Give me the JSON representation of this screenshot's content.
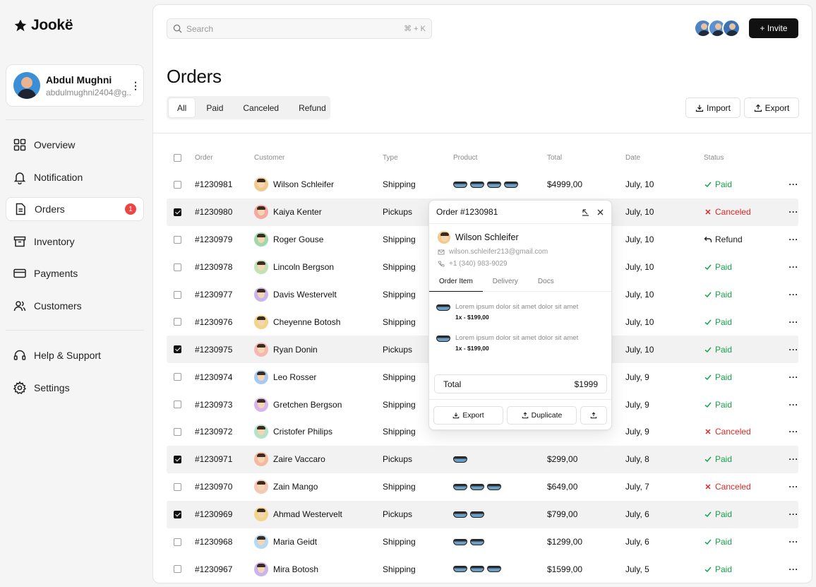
{
  "app": {
    "name": "Jookë"
  },
  "user": {
    "name": "Abdul Mughni",
    "email": "abdulmughni2404@g..."
  },
  "nav": [
    {
      "label": "Overview",
      "icon": "grid-icon"
    },
    {
      "label": "Notification",
      "icon": "bell-icon"
    },
    {
      "label": "Orders",
      "icon": "document-icon",
      "badge": "1",
      "active": true
    },
    {
      "label": "Inventory",
      "icon": "archive-icon"
    },
    {
      "label": "Payments",
      "icon": "credit-card-icon"
    },
    {
      "label": "Customers",
      "icon": "users-icon"
    }
  ],
  "nav_secondary": [
    {
      "label": "Help & Support",
      "icon": "headset-icon"
    },
    {
      "label": "Settings",
      "icon": "gear-icon"
    }
  ],
  "search": {
    "placeholder": "Search",
    "shortcut": "⌘ + K"
  },
  "invite_label": "+ Invite",
  "page": {
    "title": "Orders"
  },
  "tabs": [
    "All",
    "Paid",
    "Canceled",
    "Refund"
  ],
  "actions": {
    "import": "Import",
    "export": "Export"
  },
  "columns": [
    "Order",
    "Customer",
    "Type",
    "Product",
    "Total",
    "Date",
    "Status"
  ],
  "orders": [
    {
      "id": "#1230981",
      "customer": "Wilson Schleifer",
      "type": "Shipping",
      "products": 4,
      "total": "$4999,00",
      "date": "July, 10",
      "status": "Paid",
      "checked": false
    },
    {
      "id": "#1230980",
      "customer": "Kaiya Kenter",
      "type": "Pickups",
      "products": 0,
      "total": "",
      "date": "July, 10",
      "status": "Canceled",
      "checked": true
    },
    {
      "id": "#1230979",
      "customer": "Roger Gouse",
      "type": "Shipping",
      "products": 0,
      "total": "",
      "date": "July, 10",
      "status": "Refund",
      "checked": false
    },
    {
      "id": "#1230978",
      "customer": "Lincoln Bergson",
      "type": "Shipping",
      "products": 0,
      "total": "",
      "date": "July, 10",
      "status": "Paid",
      "checked": false
    },
    {
      "id": "#1230977",
      "customer": "Davis Westervelt",
      "type": "Shipping",
      "products": 0,
      "total": "",
      "date": "July, 10",
      "status": "Paid",
      "checked": false
    },
    {
      "id": "#1230976",
      "customer": "Cheyenne Botosh",
      "type": "Shipping",
      "products": 0,
      "total": "",
      "date": "July, 10",
      "status": "Paid",
      "checked": false
    },
    {
      "id": "#1230975",
      "customer": "Ryan Donin",
      "type": "Pickups",
      "products": 0,
      "total": "",
      "date": "July, 10",
      "status": "Paid",
      "checked": true
    },
    {
      "id": "#1230974",
      "customer": "Leo Rosser",
      "type": "Shipping",
      "products": 0,
      "total": "",
      "date": "July, 9",
      "status": "Paid",
      "checked": false
    },
    {
      "id": "#1230973",
      "customer": "Gretchen Bergson",
      "type": "Shipping",
      "products": 0,
      "total": "",
      "date": "July, 9",
      "status": "Paid",
      "checked": false
    },
    {
      "id": "#1230972",
      "customer": "Cristofer Philips",
      "type": "Shipping",
      "products": 0,
      "total": "",
      "date": "July, 9",
      "status": "Canceled",
      "checked": false
    },
    {
      "id": "#1230971",
      "customer": "Zaire Vaccaro",
      "type": "Pickups",
      "products": 1,
      "total": "$299,00",
      "date": "July, 8",
      "status": "Paid",
      "checked": true
    },
    {
      "id": "#1230970",
      "customer": "Zain Mango",
      "type": "Shipping",
      "products": 3,
      "total": "$649,00",
      "date": "July, 7",
      "status": "Canceled",
      "checked": false
    },
    {
      "id": "#1230969",
      "customer": "Ahmad Westervelt",
      "type": "Pickups",
      "products": 2,
      "total": "$799,00",
      "date": "July, 6",
      "status": "Paid",
      "checked": true
    },
    {
      "id": "#1230968",
      "customer": "Maria Geidt",
      "type": "Shipping",
      "products": 2,
      "total": "$1299,00",
      "date": "July, 6",
      "status": "Paid",
      "checked": false
    },
    {
      "id": "#1230967",
      "customer": "Mira Botosh",
      "type": "Shipping",
      "products": 3,
      "total": "$1599,00",
      "date": "July, 5",
      "status": "Paid",
      "checked": false
    }
  ],
  "status_colors": {
    "Paid": "#16a34a",
    "Canceled": "#dc2626",
    "Refund": "#222222"
  },
  "popover": {
    "title": "Order #1230981",
    "customer": "Wilson Schleifer",
    "email": "wilson.schleifer213@gmail.com",
    "phone": "+1 (340) 983-9029",
    "tabs": [
      "Order Item",
      "Delivery",
      "Docs"
    ],
    "items": [
      {
        "desc": "Lorem ipsum dolor sit amet dolor sit amet",
        "qty": "1x - $199,00"
      },
      {
        "desc": "Lorem ipsum dolor sit amet dolor sit amet",
        "qty": "1x - $199,00"
      }
    ],
    "total_label": "Total",
    "total_value": "$1999",
    "export_label": "Export",
    "duplicate_label": "Duplicate"
  }
}
